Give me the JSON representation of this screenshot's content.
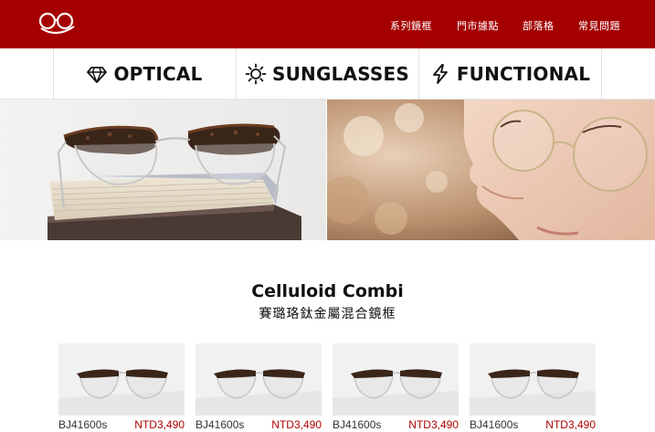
{
  "header": {
    "nav": [
      {
        "label": "系列鏡框"
      },
      {
        "label": "門市據點"
      },
      {
        "label": "部落格"
      },
      {
        "label": "常見問題"
      }
    ],
    "colors": {
      "brand": "#a50000",
      "price": "#b00000"
    }
  },
  "categories": [
    {
      "label": "OPTICAL",
      "icon": "diamond-icon"
    },
    {
      "label": "SUNGLASSES",
      "icon": "sun-icon"
    },
    {
      "label": "FUNCTIONAL",
      "icon": "lightning-icon"
    }
  ],
  "section": {
    "title": "Celluloid Combi",
    "subtitle": "賽璐珞鈦金屬混合鏡框"
  },
  "products": [
    {
      "code": "BJ41600s",
      "price": "NTD3,490"
    },
    {
      "code": "BJ41600s",
      "price": "NTD3,490"
    },
    {
      "code": "BJ41600s",
      "price": "NTD3,490"
    },
    {
      "code": "BJ41600s",
      "price": "NTD3,490"
    }
  ]
}
